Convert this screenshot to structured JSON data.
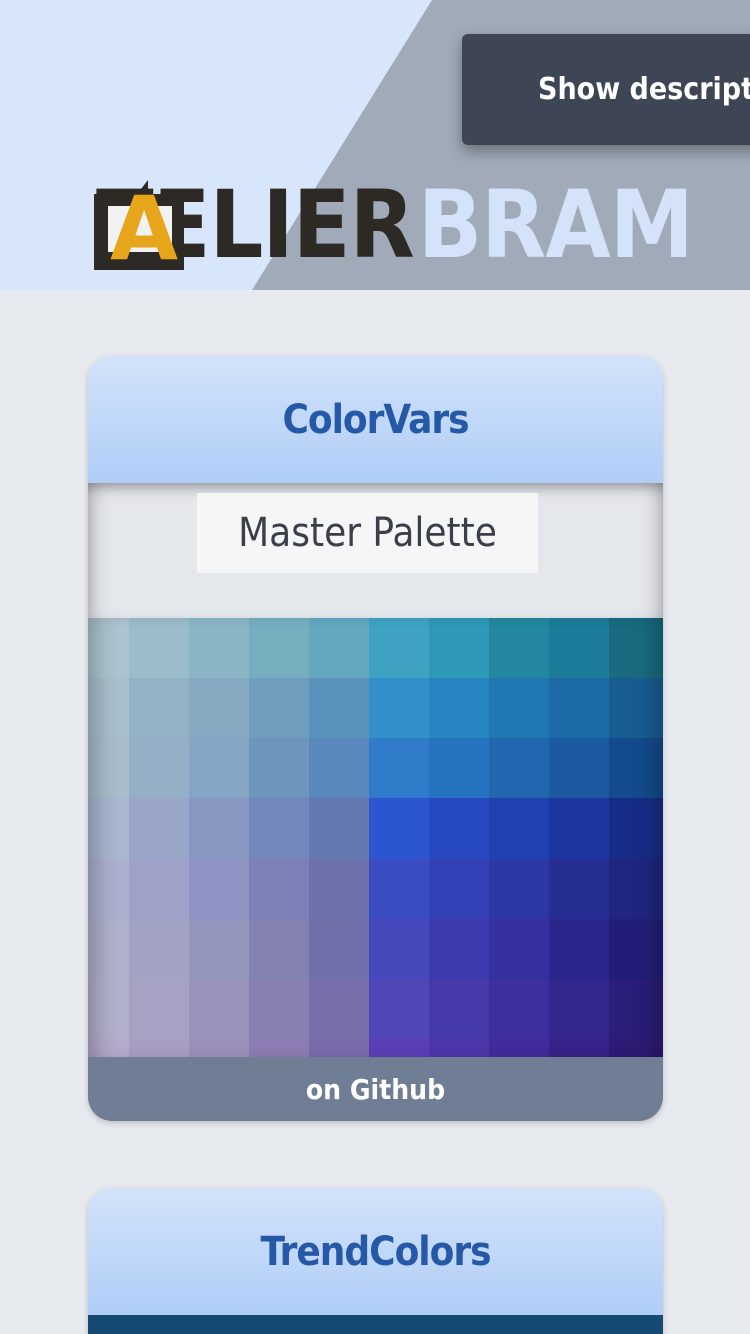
{
  "header": {
    "show_description": "Show description",
    "logo": {
      "mark_letter": "A",
      "word_dark": "TELIER",
      "word_light": "BRAM"
    }
  },
  "cards": [
    {
      "title": "ColorVars",
      "palette_title": "Master Palette",
      "footer_link": "on Github",
      "swatch_rows": [
        [
          "#acc4cf",
          "#9bbcc9",
          "#8ab5c5",
          "#77aebf",
          "#64a8bf",
          "#3fa2c3",
          "#2e98b7",
          "#23889f",
          "#1c7c99",
          "#1a6b80"
        ],
        [
          "#a9bfcc",
          "#94b2c6",
          "#84a9c1",
          "#6e9dbd",
          "#5a92bb",
          "#3490cb",
          "#2786c1",
          "#2177b2",
          "#1d6ba6",
          "#185d92"
        ],
        [
          "#a8bccb",
          "#95b0c6",
          "#84a5c3",
          "#6e95bc",
          "#5a88bc",
          "#317cca",
          "#2673bf",
          "#2167b0",
          "#1b5aa0",
          "#134b8c"
        ],
        [
          "#a9b6cf",
          "#99a6c8",
          "#8897c2",
          "#7487bc",
          "#6479b1",
          "#2c55d1",
          "#2649c0",
          "#2140b2",
          "#1e36a2",
          "#172c87"
        ],
        [
          "#abb0cf",
          "#9ea1c8",
          "#8d93c2",
          "#7d80b6",
          "#6d71ac",
          "#3b4dc3",
          "#3441b6",
          "#2e37a6",
          "#262e94",
          "#1f2680"
        ],
        [
          "#afb1cb",
          "#a2a3c4",
          "#9596bd",
          "#8380b2",
          "#7070aa",
          "#4648bc",
          "#3d3aaf",
          "#3530a0",
          "#2b268e",
          "#221e78"
        ],
        [
          "#b1b0cb",
          "#a5a2c3",
          "#9893bc",
          "#8880b3",
          "#786faa",
          "#5046b8",
          "#4639ac",
          "#3d309e",
          "#33268d",
          "#291e78"
        ],
        [
          "#b3abc9",
          "#a79dc1",
          "#9c90ba",
          "#8d7cb2",
          "#7c6baa",
          "#5a3fb7",
          "#4f35aa",
          "#432b9c",
          "#38228a",
          "#2e1b75"
        ]
      ]
    },
    {
      "title": "TrendColors"
    }
  ]
}
